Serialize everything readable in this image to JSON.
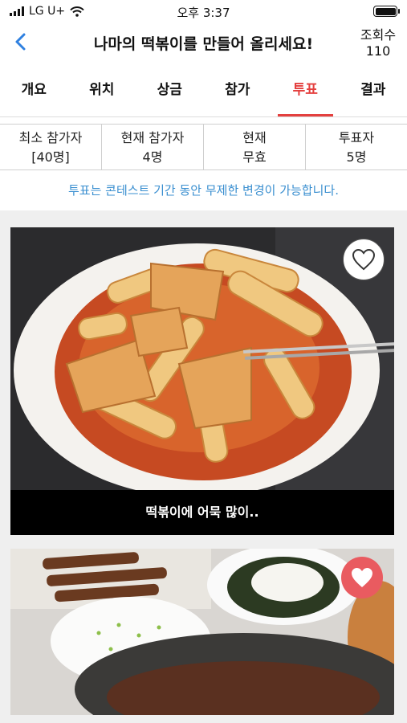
{
  "status_bar": {
    "carrier": "LG U+",
    "time": "오후 3:37"
  },
  "header": {
    "title": "나마의 떡볶이를 만들어 올리세요!",
    "views_label": "조회수",
    "views_count": "110"
  },
  "tabs": [
    {
      "label": "개요",
      "active": false
    },
    {
      "label": "위치",
      "active": false
    },
    {
      "label": "상금",
      "active": false
    },
    {
      "label": "참가",
      "active": false
    },
    {
      "label": "투표",
      "active": true
    },
    {
      "label": "결과",
      "active": false
    }
  ],
  "stats": [
    {
      "label": "최소 참가자",
      "value": "[40명]"
    },
    {
      "label": "현재 참가자",
      "value": "4명"
    },
    {
      "label": "현재",
      "value": "무효"
    },
    {
      "label": "투표자",
      "value": "5명"
    }
  ],
  "notice": "투표는 콘테스트 기간 동안 무제한 변경이 가능합니다.",
  "entries": [
    {
      "caption": "떡볶이에 어묵 많이..",
      "liked": false
    },
    {
      "caption": "",
      "liked": true
    }
  ],
  "colors": {
    "accent": "#e4403f",
    "notice": "#3a8fd0",
    "like": "#e95b60"
  },
  "icons": {
    "back": "chevron-left-icon",
    "heart_outline": "heart-outline-icon",
    "heart_filled": "heart-filled-icon",
    "wifi": "wifi-icon",
    "battery": "battery-icon"
  }
}
